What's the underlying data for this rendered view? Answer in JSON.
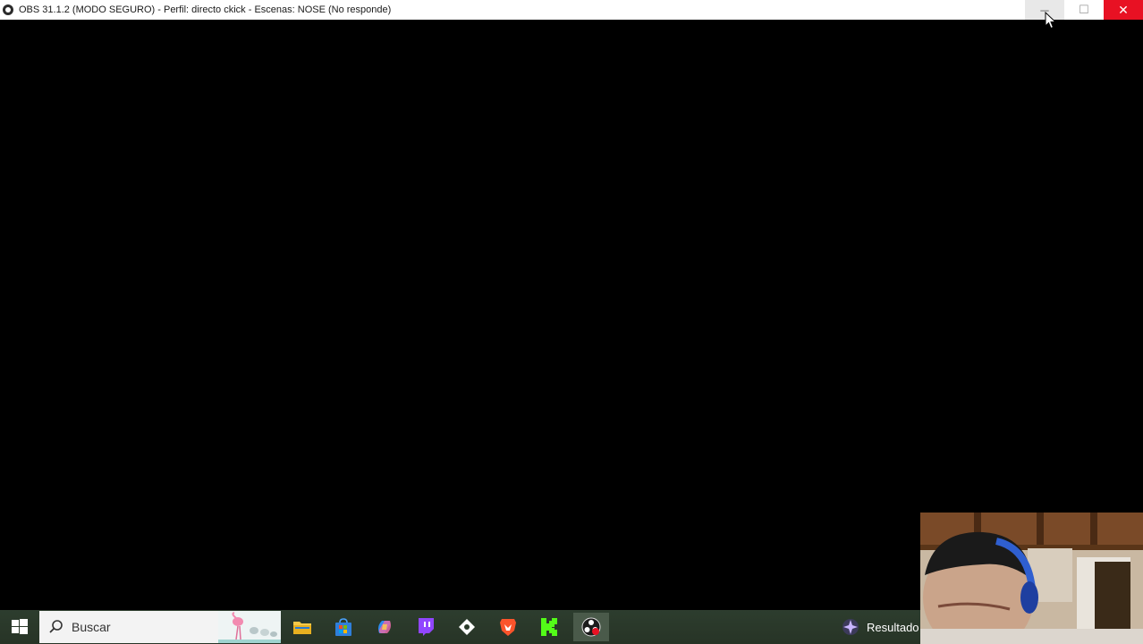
{
  "window": {
    "title": "OBS 31.1.2 (MODO SEGURO) - Perfil: directo ckick - Escenas: NOSE (No responde)"
  },
  "window_controls": {
    "minimize": "─",
    "maximize": "☐",
    "close": "✕"
  },
  "taskbar": {
    "search_placeholder": "Buscar",
    "apps": [
      "file-explorer",
      "microsoft-store",
      "copilot",
      "twitch",
      "app-diamond",
      "brave",
      "kick",
      "obs"
    ],
    "tray_label": "Resultado"
  },
  "colors": {
    "close_red": "#e81123",
    "taskbar": "#2b3b2b",
    "kick_green": "#53fc18",
    "twitch_purple": "#9146ff",
    "brave_orange": "#fb542b"
  }
}
